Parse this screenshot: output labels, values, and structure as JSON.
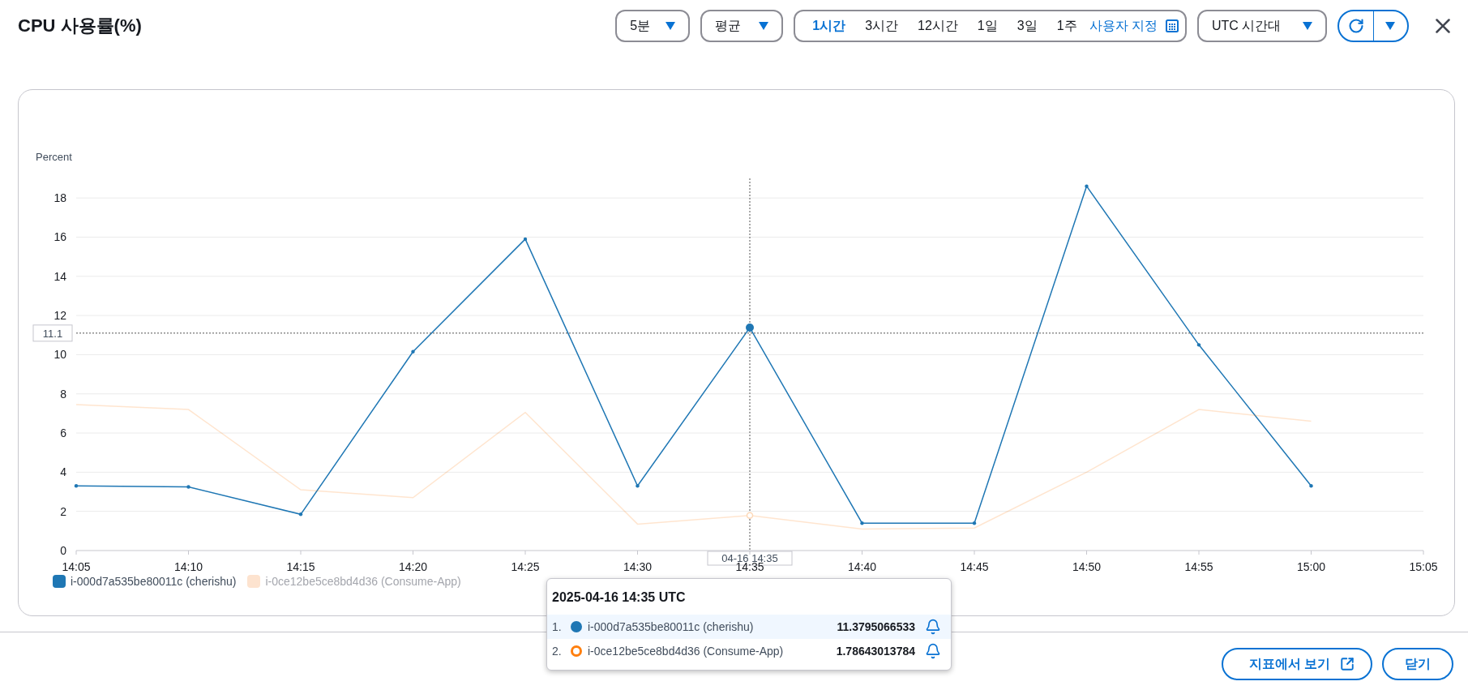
{
  "title": "CPU 사용률(%)",
  "toolbar": {
    "period": {
      "value": "5분"
    },
    "statistic": {
      "value": "평균"
    },
    "ranges": [
      {
        "label": "1시간",
        "selected": true
      },
      {
        "label": "3시간",
        "selected": false
      },
      {
        "label": "12시간",
        "selected": false
      },
      {
        "label": "1일",
        "selected": false
      },
      {
        "label": "3일",
        "selected": false
      },
      {
        "label": "1주",
        "selected": false
      }
    ],
    "custom_range": "사용자 지정",
    "timezone": {
      "value": "UTC 시간대"
    }
  },
  "chart": {
    "chart_data": {
      "type": "line",
      "ylabel": "Percent",
      "categories": [
        "14:05",
        "14:10",
        "14:15",
        "14:20",
        "14:25",
        "14:30",
        "14:35",
        "14:40",
        "14:45",
        "14:50",
        "14:55",
        "15:00",
        "15:05"
      ],
      "series": [
        {
          "name": "i-000d7a535be80011c (cherishu)",
          "color": "#1f77b4",
          "values": [
            3.3,
            3.25,
            1.85,
            10.15,
            15.9,
            3.3,
            11.38,
            1.4,
            1.4,
            18.6,
            10.5,
            3.3,
            null
          ]
        },
        {
          "name": "i-0ce12be5ce8bd4d36 (Consume-App)",
          "color": "#ff7f0e",
          "values": [
            7.45,
            7.2,
            3.1,
            2.7,
            7.05,
            1.35,
            1.79,
            1.1,
            1.15,
            4.0,
            7.2,
            6.6,
            null
          ]
        }
      ],
      "ylim": [
        0,
        19
      ],
      "yticks": [
        0,
        2,
        4,
        6,
        8,
        10,
        12,
        14,
        16,
        18
      ],
      "grid": true,
      "ref_lines": [
        {
          "axis": "y",
          "value": 11.1,
          "label": "11.1"
        },
        {
          "axis": "x",
          "value": "14:35",
          "label": "04-16 14:35"
        }
      ]
    },
    "legend": [
      {
        "dimmed": false
      },
      {
        "dimmed": true
      }
    ]
  },
  "tooltip": {
    "title": "2025-04-16 14:35 UTC",
    "rows": [
      {
        "index": "1.",
        "kind": "filled",
        "name": "i-000d7a535be80011c (cherishu)",
        "value": "11.3795066533",
        "selected": true
      },
      {
        "index": "2.",
        "kind": "ring",
        "name": "i-0ce12be5ce8bd4d36 (Consume-App)",
        "value": "1.78643013784",
        "selected": false
      }
    ]
  },
  "footer": {
    "buttons": [
      {
        "label": "지표에서 보기",
        "kind": "external"
      },
      {
        "label": "닫기",
        "kind": "plain"
      }
    ]
  }
}
